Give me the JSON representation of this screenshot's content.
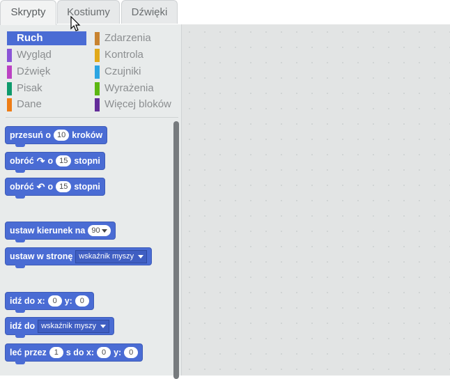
{
  "tabs": [
    "Skrypty",
    "Kostiumy",
    "Dźwięki"
  ],
  "categories_left": [
    {
      "label": "Ruch",
      "color": "#4a6cd4"
    },
    {
      "label": "Wygląd",
      "color": "#8a55d7"
    },
    {
      "label": "Dźwięk",
      "color": "#bb42c3"
    },
    {
      "label": "Pisak",
      "color": "#0e9a6c"
    },
    {
      "label": "Dane",
      "color": "#ee7d16"
    }
  ],
  "categories_right": [
    {
      "label": "Zdarzenia",
      "color": "#c88330"
    },
    {
      "label": "Kontrola",
      "color": "#e1a91a"
    },
    {
      "label": "Czujniki",
      "color": "#2ca5e2"
    },
    {
      "label": "Wyrażenia",
      "color": "#5cb712"
    },
    {
      "label": "Więcej bloków",
      "color": "#632d99"
    }
  ],
  "blocks": {
    "move": {
      "a": "przesuń o",
      "n": "10",
      "b": "kroków"
    },
    "turn_right": {
      "a": "obróć",
      "o": "o",
      "n": "15",
      "b": "stopni"
    },
    "turn_left": {
      "a": "obróć",
      "o": "o",
      "n": "15",
      "b": "stopni"
    },
    "point_dir": {
      "a": "ustaw kierunek na",
      "n": "90"
    },
    "point_towards": {
      "a": "ustaw w stronę",
      "dd": "wskaźnik myszy"
    },
    "goto_xy": {
      "a": "idź do x:",
      "x": "0",
      "yl": "y:",
      "y": "0"
    },
    "goto": {
      "a": "idź do",
      "dd": "wskaźnik myszy"
    },
    "glide": {
      "a": "leć przez",
      "s": "1",
      "b": "s do x:",
      "x": "0",
      "yl": "y:",
      "y": "0"
    }
  }
}
